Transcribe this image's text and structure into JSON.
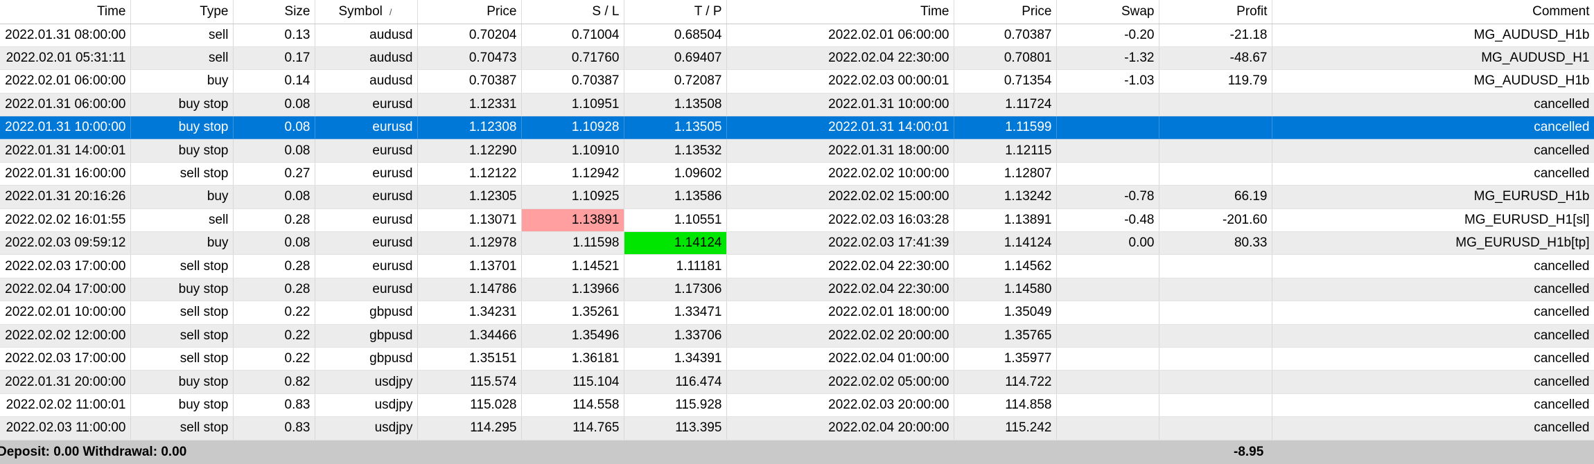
{
  "columns": [
    {
      "key": "time",
      "label": "Time"
    },
    {
      "key": "type",
      "label": "Type"
    },
    {
      "key": "size",
      "label": "Size"
    },
    {
      "key": "symbol",
      "label": "Symbol",
      "sort_indicator": "/"
    },
    {
      "key": "price",
      "label": "Price"
    },
    {
      "key": "sl",
      "label": "S / L"
    },
    {
      "key": "tp",
      "label": "T / P"
    },
    {
      "key": "close_time",
      "label": "Time"
    },
    {
      "key": "close_price",
      "label": "Price"
    },
    {
      "key": "swap",
      "label": "Swap"
    },
    {
      "key": "profit",
      "label": "Profit"
    },
    {
      "key": "comment",
      "label": "Comment"
    }
  ],
  "rows": [
    {
      "time": "2022.01.31 08:00:00",
      "type": "sell",
      "size": "0.13",
      "symbol": "audusd",
      "price": "0.70204",
      "sl": "0.71004",
      "tp": "0.68504",
      "close_time": "2022.02.01 06:00:00",
      "close_price": "0.70387",
      "swap": "-0.20",
      "profit": "-21.18",
      "comment": "MG_AUDUSD_H1b"
    },
    {
      "time": "2022.02.01 05:31:11",
      "type": "sell",
      "size": "0.17",
      "symbol": "audusd",
      "price": "0.70473",
      "sl": "0.71760",
      "tp": "0.69407",
      "close_time": "2022.02.04 22:30:00",
      "close_price": "0.70801",
      "swap": "-1.32",
      "profit": "-48.67",
      "comment": "MG_AUDUSD_H1"
    },
    {
      "time": "2022.02.01 06:00:00",
      "type": "buy",
      "size": "0.14",
      "symbol": "audusd",
      "price": "0.70387",
      "sl": "0.70387",
      "tp": "0.72087",
      "close_time": "2022.02.03 00:00:01",
      "close_price": "0.71354",
      "swap": "-1.03",
      "profit": "119.79",
      "comment": "MG_AUDUSD_H1b"
    },
    {
      "time": "2022.01.31 06:00:00",
      "type": "buy stop",
      "size": "0.08",
      "symbol": "eurusd",
      "price": "1.12331",
      "sl": "1.10951",
      "tp": "1.13508",
      "close_time": "2022.01.31 10:00:00",
      "close_price": "1.11724",
      "swap": "",
      "profit": "",
      "comment": "cancelled"
    },
    {
      "time": "2022.01.31 10:00:00",
      "type": "buy stop",
      "size": "0.08",
      "symbol": "eurusd",
      "price": "1.12308",
      "sl": "1.10928",
      "tp": "1.13505",
      "close_time": "2022.01.31 14:00:01",
      "close_price": "1.11599",
      "swap": "",
      "profit": "",
      "comment": "cancelled",
      "selected": true
    },
    {
      "time": "2022.01.31 14:00:01",
      "type": "buy stop",
      "size": "0.08",
      "symbol": "eurusd",
      "price": "1.12290",
      "sl": "1.10910",
      "tp": "1.13532",
      "close_time": "2022.01.31 18:00:00",
      "close_price": "1.12115",
      "swap": "",
      "profit": "",
      "comment": "cancelled"
    },
    {
      "time": "2022.01.31 16:00:00",
      "type": "sell stop",
      "size": "0.27",
      "symbol": "eurusd",
      "price": "1.12122",
      "sl": "1.12942",
      "tp": "1.09602",
      "close_time": "2022.02.02 10:00:00",
      "close_price": "1.12807",
      "swap": "",
      "profit": "",
      "comment": "cancelled"
    },
    {
      "time": "2022.01.31 20:16:26",
      "type": "buy",
      "size": "0.08",
      "symbol": "eurusd",
      "price": "1.12305",
      "sl": "1.10925",
      "tp": "1.13586",
      "close_time": "2022.02.02 15:00:00",
      "close_price": "1.13242",
      "swap": "-0.78",
      "profit": "66.19",
      "comment": "MG_EURUSD_H1b"
    },
    {
      "time": "2022.02.02 16:01:55",
      "type": "sell",
      "size": "0.28",
      "symbol": "eurusd",
      "price": "1.13071",
      "sl": "1.13891",
      "tp": "1.10551",
      "close_time": "2022.02.03 16:03:28",
      "close_price": "1.13891",
      "swap": "-0.48",
      "profit": "-201.60",
      "comment": "MG_EURUSD_H1[sl]",
      "sl_hit": true
    },
    {
      "time": "2022.02.03 09:59:12",
      "type": "buy",
      "size": "0.08",
      "symbol": "eurusd",
      "price": "1.12978",
      "sl": "1.11598",
      "tp": "1.14124",
      "close_time": "2022.02.03 17:41:39",
      "close_price": "1.14124",
      "swap": "0.00",
      "profit": "80.33",
      "comment": "MG_EURUSD_H1b[tp]",
      "tp_hit": true
    },
    {
      "time": "2022.02.03 17:00:00",
      "type": "sell stop",
      "size": "0.28",
      "symbol": "eurusd",
      "price": "1.13701",
      "sl": "1.14521",
      "tp": "1.11181",
      "close_time": "2022.02.04 22:30:00",
      "close_price": "1.14562",
      "swap": "",
      "profit": "",
      "comment": "cancelled"
    },
    {
      "time": "2022.02.04 17:00:00",
      "type": "buy stop",
      "size": "0.28",
      "symbol": "eurusd",
      "price": "1.14786",
      "sl": "1.13966",
      "tp": "1.17306",
      "close_time": "2022.02.04 22:30:00",
      "close_price": "1.14580",
      "swap": "",
      "profit": "",
      "comment": "cancelled"
    },
    {
      "time": "2022.02.01 10:00:00",
      "type": "sell stop",
      "size": "0.22",
      "symbol": "gbpusd",
      "price": "1.34231",
      "sl": "1.35261",
      "tp": "1.33471",
      "close_time": "2022.02.01 18:00:00",
      "close_price": "1.35049",
      "swap": "",
      "profit": "",
      "comment": "cancelled"
    },
    {
      "time": "2022.02.02 12:00:00",
      "type": "sell stop",
      "size": "0.22",
      "symbol": "gbpusd",
      "price": "1.34466",
      "sl": "1.35496",
      "tp": "1.33706",
      "close_time": "2022.02.02 20:00:00",
      "close_price": "1.35765",
      "swap": "",
      "profit": "",
      "comment": "cancelled"
    },
    {
      "time": "2022.02.03 17:00:00",
      "type": "sell stop",
      "size": "0.22",
      "symbol": "gbpusd",
      "price": "1.35151",
      "sl": "1.36181",
      "tp": "1.34391",
      "close_time": "2022.02.04 01:00:00",
      "close_price": "1.35977",
      "swap": "",
      "profit": "",
      "comment": "cancelled"
    },
    {
      "time": "2022.01.31 20:00:00",
      "type": "buy stop",
      "size": "0.82",
      "symbol": "usdjpy",
      "price": "115.574",
      "sl": "115.104",
      "tp": "116.474",
      "close_time": "2022.02.02 05:00:00",
      "close_price": "114.722",
      "swap": "",
      "profit": "",
      "comment": "cancelled"
    },
    {
      "time": "2022.02.02 11:00:01",
      "type": "buy stop",
      "size": "0.83",
      "symbol": "usdjpy",
      "price": "115.028",
      "sl": "114.558",
      "tp": "115.928",
      "close_time": "2022.02.03 20:00:00",
      "close_price": "114.858",
      "swap": "",
      "profit": "",
      "comment": "cancelled"
    },
    {
      "time": "2022.02.03 11:00:00",
      "type": "sell stop",
      "size": "0.83",
      "symbol": "usdjpy",
      "price": "114.295",
      "sl": "114.765",
      "tp": "113.395",
      "close_time": "2022.02.04 20:00:00",
      "close_price": "115.242",
      "swap": "",
      "profit": "",
      "comment": "cancelled"
    }
  ],
  "footer": {
    "summary": "Deposit: 0.00  Withdrawal: 0.00",
    "total_profit": "-8.95"
  },
  "colors": {
    "selected_row": "#0078d7",
    "stop_loss_hit": "#ff9f9f",
    "take_profit_hit": "#00e600",
    "footer_bg": "#c9c9c9"
  }
}
